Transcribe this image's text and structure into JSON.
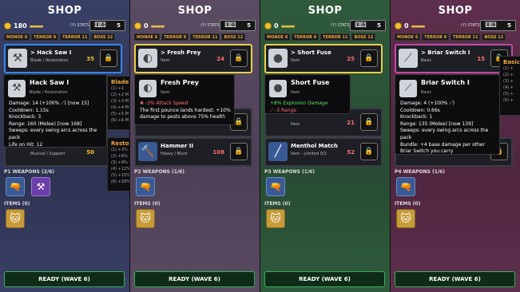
{
  "panels": [
    {
      "bg": "#3a3f5e",
      "shop_title": "SHOP",
      "gold": "180",
      "stats_label": "(Y) STATS",
      "dice_count": "5",
      "tags": [
        "MONOE 6",
        "TERROR 9",
        "TERROR 11",
        "BOSS 12"
      ],
      "cards": [
        {
          "name": "> Hack Saw I",
          "sub": "Blade / Restoration",
          "price": "35",
          "icon": "⚒"
        },
        {
          "name": "",
          "sub": "",
          "price": "",
          "icon": ""
        },
        {
          "name": "",
          "sub": "",
          "price": "",
          "icon": ""
        },
        {
          "name": "",
          "sub": "Musical / Support",
          "price": "50",
          "icon": ""
        }
      ],
      "tooltip": {
        "name": "Hack Saw I",
        "sub": "Blade / Restoration",
        "icon": "⚒",
        "lines": [
          "Damage: 14 (+100% ⟋) [now 15]",
          "Cooldown: 1.15s",
          "Knockback: 3",
          "Range: 160 (Melee) [now 168]",
          "Sweeps: every swing arcs across the",
          "pack",
          "Life on Hit: 12"
        ]
      },
      "side_top": {
        "title": "Blade",
        "rows": [
          "(1) +1",
          "(2) +2 M",
          "(3) +3 M",
          "(4) +4 M",
          "(5) +5 M",
          "(6) +6 M"
        ]
      },
      "side_bottom": {
        "title": "Restor",
        "rows": [
          "(1) +3%",
          "(2) +6%",
          "(3) +9%",
          "(4) +12%",
          "(5) +15%",
          "(6) +18%"
        ]
      },
      "weapons_label": "P1 WEAPONS (2/6)",
      "items_label": "ITEMS (0)",
      "ready_label": "READY (WAVE 6)"
    },
    {
      "bg": "#5b4a63",
      "shop_title": "SHOP",
      "gold": "0",
      "stats_label": "(Y) STATS",
      "dice_count": "5",
      "tags": [
        "MONOE 6",
        "TERROR 9",
        "TERROR 11",
        "BOSS 12"
      ],
      "cards": [
        {
          "name": "> Fresh Prey",
          "sub": "Item",
          "price": "24",
          "icon": "◐"
        },
        {
          "name": "",
          "sub": "",
          "price": "",
          "icon": ""
        },
        {
          "name": "",
          "sub": "",
          "price": "",
          "icon": ""
        },
        {
          "name": "Hammer II",
          "sub": "Heavy / Blunt",
          "price": "108",
          "icon": "🔨"
        }
      ],
      "tooltip": {
        "name": "Fresh Prey",
        "sub": "Item",
        "icon": "◐",
        "lines": [
          "✖ -3% Attack Speed",
          "The first pounce lands hardest: +10%",
          "damage to pests above 75% health"
        ]
      },
      "weapons_label": "P2 WEAPONS (1/6)",
      "items_label": "ITEMS (0)",
      "ready_label": "READY (WAVE 6)"
    },
    {
      "bg": "#2f5a3c",
      "shop_title": "SHOP",
      "gold": "0",
      "stats_label": "(Y) STATS",
      "dice_count": "5",
      "tags": [
        "MONOE 6",
        "TERROR 9",
        "TERROR 11",
        "BOSS 12"
      ],
      "cards": [
        {
          "name": "> Short Fuse",
          "sub": "Item",
          "price": "25",
          "icon": "●"
        },
        {
          "name": "",
          "sub": "",
          "price": "",
          "icon": ""
        },
        {
          "name": "",
          "sub": "Item",
          "price": "21",
          "icon": ""
        },
        {
          "name": "Menthol Match",
          "sub": "Item - Limited 0/2",
          "price": "52",
          "icon": "╱"
        }
      ],
      "tooltip": {
        "name": "Short Fuse",
        "sub": "Item",
        "icon": "●",
        "lines": [
          "+8% Explosion Damage",
          "⟋ -3 Range"
        ]
      },
      "weapons_label": "P3 WEAPONS (1/6)",
      "items_label": "ITEMS (0)",
      "ready_label": "READY (WAVE 6)"
    },
    {
      "bg": "#5e2f4c",
      "shop_title": "SHOP",
      "gold": "0",
      "stats_label": "(Y) STATS",
      "dice_count": "5",
      "tags": [
        "MONOE 6",
        "TERROR 9",
        "TERROR 11",
        "BOSS 12"
      ],
      "cards": [
        {
          "name": "> Briar Switch I",
          "sub": "Basic",
          "price": "15",
          "icon": "⟋"
        },
        {
          "name": "",
          "sub": "",
          "price": "",
          "icon": ""
        },
        {
          "name": "",
          "sub": "",
          "price": "",
          "icon": ""
        },
        {
          "name": "",
          "sub": "",
          "price": "",
          "icon": ""
        }
      ],
      "tooltip": {
        "name": "Briar Switch I",
        "sub": "Basic",
        "icon": "⟋",
        "lines": [
          "Damage: 4 (+100% ⟋)",
          "Cooldown: 0.66s",
          "Knockback: 1",
          "Range: 135 (Melee) [now 139]",
          "Sweeps: every swing arcs across the",
          "pack",
          "Bundle: +4 base damage per other",
          "Briar Switch you carry"
        ]
      },
      "side_top": {
        "title": "Basic",
        "rows": [
          "(1) +",
          "(2) +",
          "(3) +",
          "(4) +",
          "(5) +",
          "(6) +"
        ]
      },
      "weapons_label": "P4 WEAPONS (1/6)",
      "items_label": "ITEMS (0)",
      "ready_label": "READY (WAVE 6)"
    }
  ],
  "icons": {
    "lock": "lock-icon",
    "dice": "dice-icon",
    "coin": "coin-icon",
    "cat": "cat-item-icon",
    "gun": "water-gun-icon"
  }
}
